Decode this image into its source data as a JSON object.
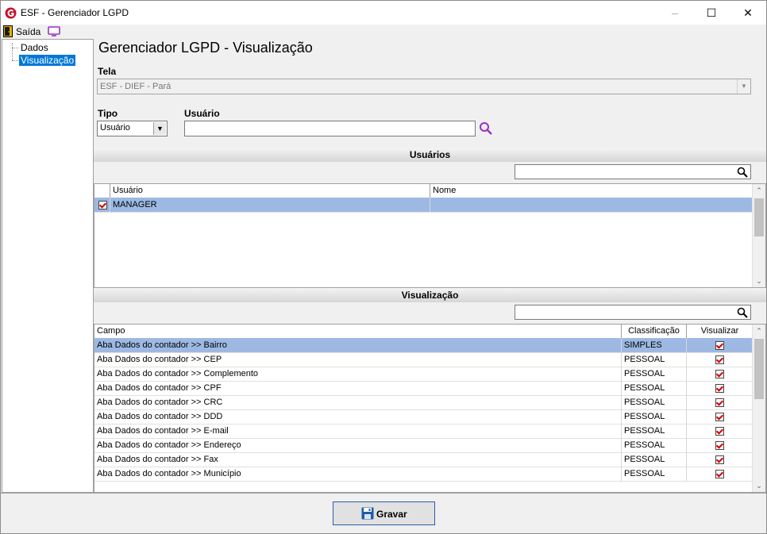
{
  "window": {
    "title": "ESF - Gerenciador LGPD",
    "controls": {
      "minimize": "–",
      "maximize": "☐",
      "close": "✕"
    }
  },
  "toolbar": {
    "exit_label": "Saída"
  },
  "tree": {
    "items": [
      {
        "label": "Dados",
        "selected": false
      },
      {
        "label": "Visualização",
        "selected": true
      }
    ]
  },
  "page": {
    "title": "Gerenciador LGPD - Visualização"
  },
  "form": {
    "tela_label": "Tela",
    "tela_value": "ESF - DIEF - Pará",
    "tipo_label": "Tipo",
    "tipo_value": "Usuário",
    "usuario_label": "Usuário",
    "usuario_value": ""
  },
  "users_section": {
    "title": "Usuários",
    "search_value": "",
    "columns": [
      "Usuário",
      "Nome"
    ],
    "rows": [
      {
        "checked": true,
        "usuario": "MANAGER",
        "nome": ""
      }
    ]
  },
  "view_section": {
    "title": "Visualização",
    "search_value": "",
    "columns": [
      "Campo",
      "Classificação",
      "Visualizar"
    ],
    "rows": [
      {
        "campo": "Aba Dados do contador >> Bairro",
        "classificacao": "SIMPLES",
        "visualizar": true
      },
      {
        "campo": "Aba Dados do contador >> CEP",
        "classificacao": "PESSOAL",
        "visualizar": true
      },
      {
        "campo": "Aba Dados do contador >> Complemento",
        "classificacao": "PESSOAL",
        "visualizar": true
      },
      {
        "campo": "Aba Dados do contador >> CPF",
        "classificacao": "PESSOAL",
        "visualizar": true
      },
      {
        "campo": "Aba Dados do contador >> CRC",
        "classificacao": "PESSOAL",
        "visualizar": true
      },
      {
        "campo": "Aba Dados do contador >> DDD",
        "classificacao": "PESSOAL",
        "visualizar": true
      },
      {
        "campo": "Aba Dados do contador >> E-mail",
        "classificacao": "PESSOAL",
        "visualizar": true
      },
      {
        "campo": "Aba Dados do contador >> Endereço",
        "classificacao": "PESSOAL",
        "visualizar": true
      },
      {
        "campo": "Aba Dados do contador >> Fax",
        "classificacao": "PESSOAL",
        "visualizar": true
      },
      {
        "campo": "Aba Dados do contador >> Município",
        "classificacao": "PESSOAL",
        "visualizar": true
      }
    ]
  },
  "actions": {
    "save_label": "Gravar"
  },
  "colors": {
    "selection": "#9db9e3",
    "accent": "#0078d7",
    "check": "#d00000",
    "brand": "#c8102e"
  }
}
